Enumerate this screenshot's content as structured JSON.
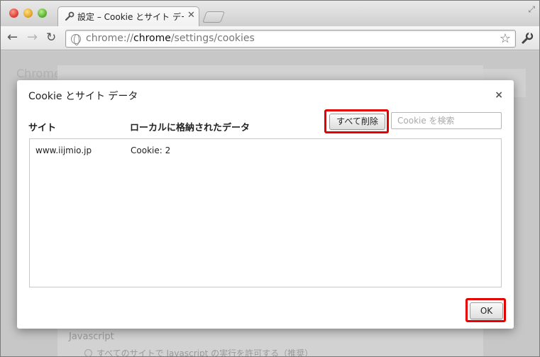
{
  "browser": {
    "tab_title": "設定 – Cookie とサイト データ",
    "url_prefix": "chrome://",
    "url_host": "chrome",
    "url_path": "/settings/cookies"
  },
  "background_page": {
    "ghost_title": "Chrome",
    "javascript_heading": "Javascript",
    "javascript_option": "すべてのサイトで Javascript の実行を許可する（推奨）"
  },
  "dialog": {
    "title": "Cookie とサイト データ",
    "close_glyph": "×",
    "columns": {
      "site": "サイト",
      "data": "ローカルに格納されたデータ"
    },
    "remove_all_label": "すべて削除",
    "search_placeholder": "Cookie を検索",
    "rows": [
      {
        "site": "www.iijmio.jp",
        "data": "Cookie: 2"
      }
    ],
    "ok_label": "OK",
    "highlight_color": "#e60000"
  }
}
